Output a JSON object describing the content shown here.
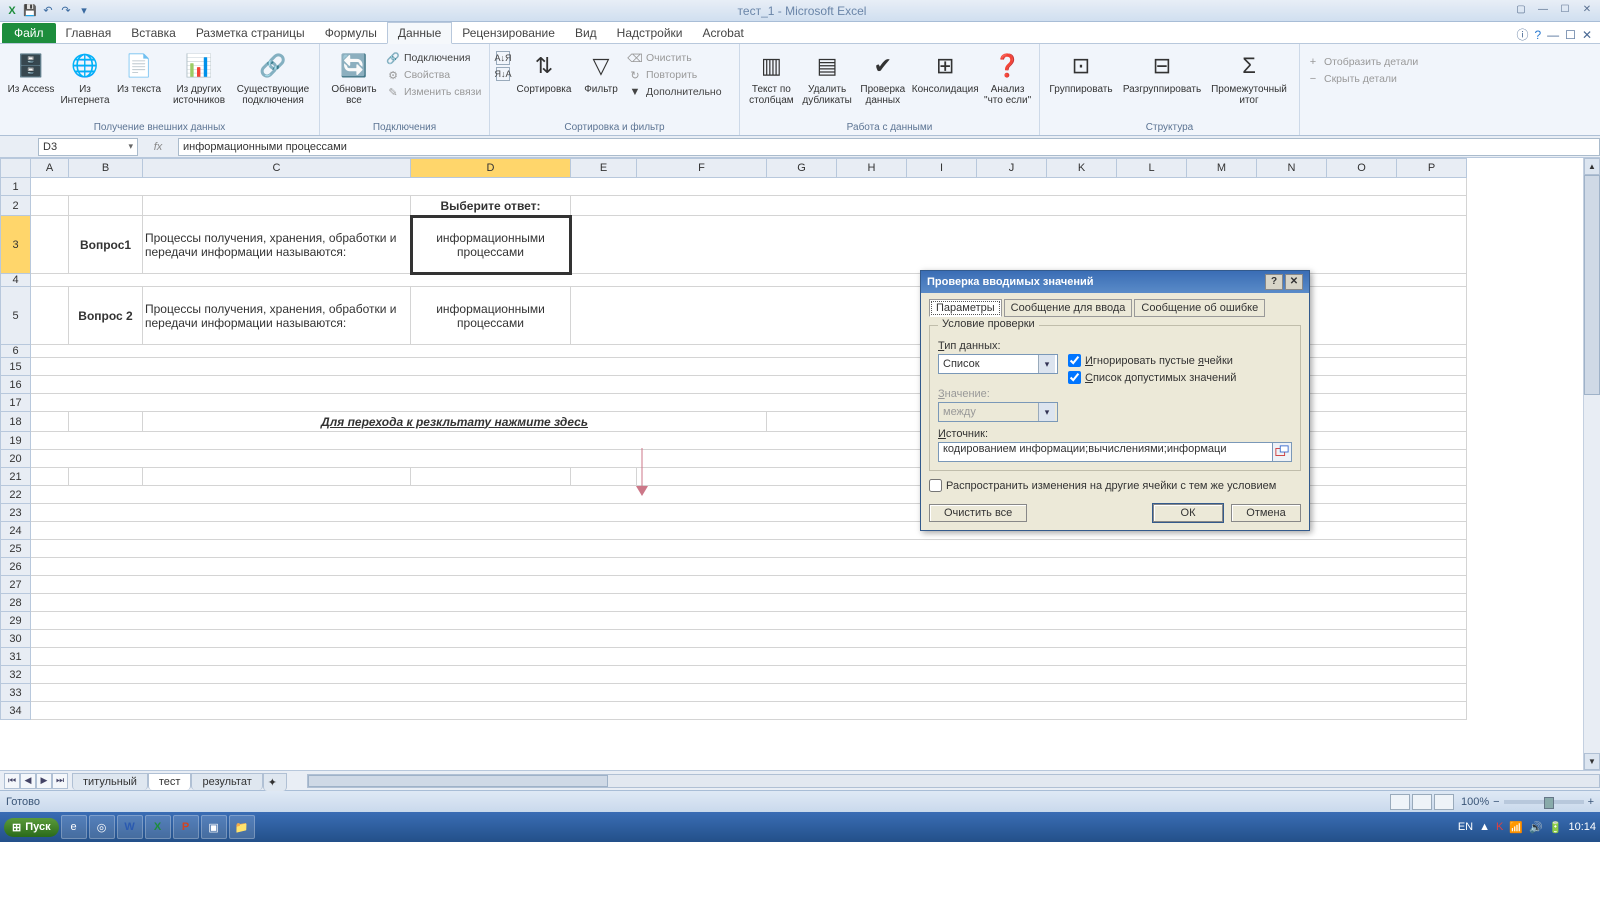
{
  "title": "тест_1 - Microsoft Excel",
  "qat": {
    "save": "💾",
    "undo": "↶",
    "redo": "↷"
  },
  "tabs": {
    "file": "Файл",
    "items": [
      "Главная",
      "Вставка",
      "Разметка страницы",
      "Формулы",
      "Данные",
      "Рецензирование",
      "Вид",
      "Надстройки",
      "Acrobat"
    ],
    "active": "Данные"
  },
  "ribbon": {
    "ext": {
      "access": "Из Access",
      "web": "Из Интернета",
      "text": "Из текста",
      "other": "Из других источников",
      "existing": "Существующие подключения",
      "label": "Получение внешних данных"
    },
    "conn": {
      "refresh": "Обновить все",
      "connections": "Подключения",
      "props": "Свойства",
      "editlinks": "Изменить связи",
      "label": "Подключения"
    },
    "sort": {
      "az": "А↓Я",
      "za": "Я↓А",
      "sort": "Сортировка",
      "filter": "Фильтр",
      "clear": "Очистить",
      "reapply": "Повторить",
      "advanced": "Дополнительно",
      "label": "Сортировка и фильтр"
    },
    "tools": {
      "ttc": "Текст по столбцам",
      "dup": "Удалить дубликаты",
      "val": "Проверка данных",
      "cons": "Консолидация",
      "whatif": "Анализ \"что если\"",
      "label": "Работа с данными"
    },
    "outline": {
      "group": "Группировать",
      "ungroup": "Разгруппировать",
      "subtotal": "Промежуточный итог",
      "show": "Отобразить детали",
      "hide": "Скрыть детали",
      "label": "Структура"
    }
  },
  "namebox": "D3",
  "formula": "информационными процессами",
  "cols": [
    "A",
    "B",
    "C",
    "D",
    "E",
    "F",
    "G",
    "H",
    "I",
    "J",
    "K",
    "L",
    "M",
    "N",
    "O",
    "P"
  ],
  "sheet": {
    "ans_header": "Выберите ответ:",
    "q1_label": "Вопрос1",
    "q1_text": "Процессы получения, хранения, обработки и передачи информации называются:",
    "q1_ans": "информационными процессами",
    "q2_label": "Вопрос 2",
    "q2_text": "Процессы получения, хранения, обработки и передачи информации называются:",
    "q2_ans": "информационными процессами",
    "link": "Для перехода  к резкльтату нажмите здесь"
  },
  "sheets": {
    "s1": "титульный",
    "s2": "тест",
    "s3": "результат"
  },
  "status": {
    "ready": "Готово",
    "zoom": "100%"
  },
  "dialog": {
    "title": "Проверка вводимых значений",
    "tabs": {
      "t1": "Параметры",
      "t2": "Сообщение для ввода",
      "t3": "Сообщение об ошибке"
    },
    "frame": "Условие проверки",
    "type_label": "Тип данных:",
    "type_value": "Список",
    "ignore": "Игнорировать пустые ячейки",
    "incell": "Список допустимых значений",
    "value_label": "Значение:",
    "value_value": "между",
    "source_label": "Источник:",
    "source_value": "кодированием информации;вычислениями;информаци",
    "apply": "Распространить изменения на другие ячейки с тем же условием",
    "clear": "Очистить все",
    "ok": "ОК",
    "cancel": "Отмена"
  },
  "taskbar": {
    "start": "Пуск",
    "lang": "EN",
    "time": "10:14"
  }
}
